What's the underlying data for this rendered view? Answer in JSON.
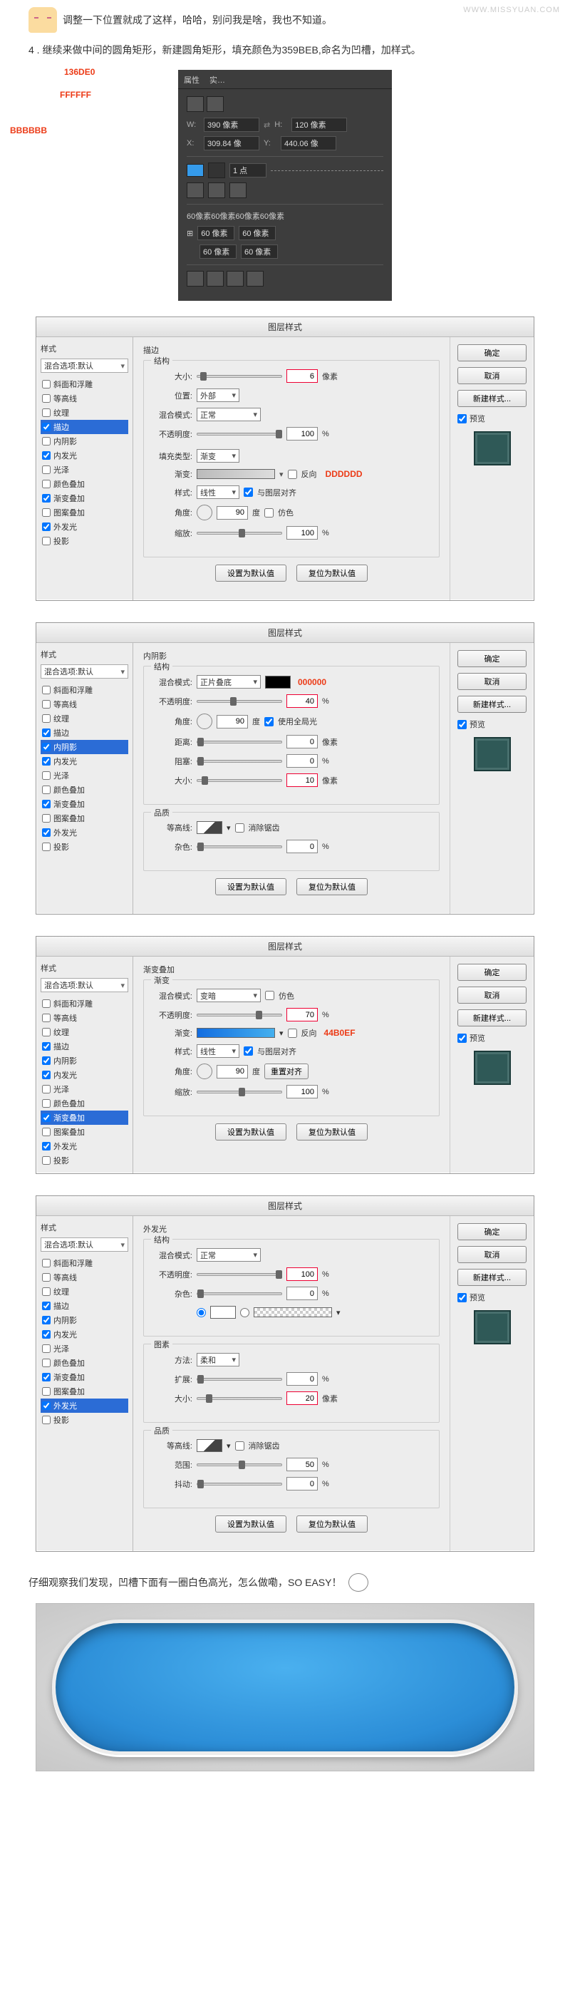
{
  "watermark": "WWW.MISSYUAN.COM",
  "intro": "调整一下位置就成了这样，哈哈，别问我是啥，我也不知道。",
  "step": "4 . 继续来做中间的圆角矩形，新建圆角矩形，填充颜色为359BEB,命名为凹槽，加样式。",
  "propPanel": {
    "tab1": "属性",
    "tab2": "实…",
    "W_label": "W:",
    "W": "390 像素",
    "H_label": "H:",
    "H": "120 像素",
    "X_label": "X:",
    "X": "309.84 像",
    "Y_label": "Y:",
    "Y": "440.06 像",
    "stroke": "1 点",
    "radii_line": "60像素60像素60像素60像素",
    "r1": "60 像素",
    "r2": "60 像素",
    "r3": "60 像素",
    "r4": "60 像素"
  },
  "dlgTitle": "图层样式",
  "left": {
    "header": "样式",
    "blend": "混合选项:默认",
    "items": [
      "斜面和浮雕",
      "等高线",
      "纹理",
      "描边",
      "内阴影",
      "内发光",
      "光泽",
      "颜色叠加",
      "渐变叠加",
      "图案叠加",
      "外发光",
      "投影"
    ]
  },
  "right": {
    "ok": "确定",
    "cancel": "取消",
    "new": "新建样式...",
    "preview": "预览"
  },
  "common": {
    "structure": "结构",
    "elements": "图素",
    "quality": "品质",
    "blendMode": "混合模式:",
    "opacity": "不透明度:",
    "angle": "角度:",
    "deg": "度",
    "setDefault": "设置为默认值",
    "resetDefault": "复位为默认值",
    "pct": "%",
    "px": "像素",
    "size": "大小:",
    "position": "位置:",
    "fillType": "填充类型:",
    "gradient": "渐变:",
    "style": "样式:",
    "reverse": "反向",
    "alignLayer": "与图层对齐",
    "scale": "缩放:",
    "dither": "仿色",
    "distance": "距离:",
    "choke": "阻塞:",
    "spread": "扩展:",
    "useGlobal": "使用全局光",
    "contour": "等高线:",
    "antiAlias": "消除锯齿",
    "noise": "杂色:",
    "range": "范围:",
    "jitter": "抖动:",
    "technique": "方法:"
  },
  "panel1": {
    "title": "描边",
    "size": "6",
    "position": "外部",
    "blend": "正常",
    "opacity": "100",
    "fillType": "渐变",
    "style": "线性",
    "angle": "90",
    "scale": "100",
    "ann_left": "BBBBBB",
    "ann_right": "DDDDDD"
  },
  "panel2": {
    "title": "内阴影",
    "blend": "正片叠底",
    "opacity": "40",
    "angle": "90",
    "distance": "0",
    "choke": "0",
    "size": "10",
    "noise": "0",
    "ann_color": "000000"
  },
  "panel3": {
    "title": "渐变叠加",
    "sub": "渐变",
    "blend": "变暗",
    "opacity": "70",
    "style": "线性",
    "angle": "90",
    "scale": "100",
    "resetAlign": "重置对齐",
    "ann_left": "136DE0",
    "ann_right": "44B0EF"
  },
  "panel4": {
    "title": "外发光",
    "blend": "正常",
    "opacity": "100",
    "noise": "0",
    "technique": "柔和",
    "spread": "0",
    "size": "20",
    "range": "50",
    "jitter": "0",
    "ann_color": "FFFFFF"
  },
  "conclusion": "仔细观察我们发现，凹槽下面有一圈白色高光，怎么做嘞，SO EASY！"
}
